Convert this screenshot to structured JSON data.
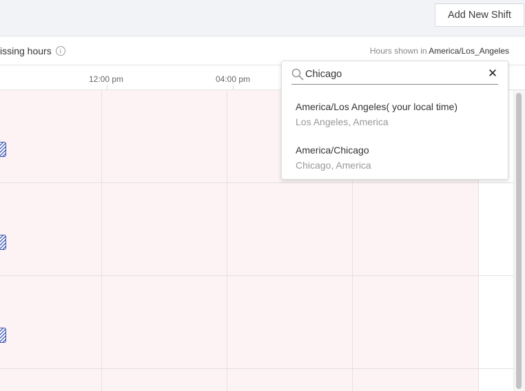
{
  "header": {
    "add_shift_label": "Add New Shift"
  },
  "infobar": {
    "missing_hours_label": "issing hours",
    "info_icon": "i",
    "hours_shown_prefix": "Hours shown in",
    "timezone": "America/Los_Angeles"
  },
  "timeline": {
    "ticks": [
      "12:00 pm",
      "04:00 pm"
    ]
  },
  "timezone_dropdown": {
    "search_value": "Chicago",
    "search_placeholder": "",
    "clear_symbol": "✕",
    "options": [
      {
        "title": "America/Los Angeles( your local time)",
        "subtitle": "Los Angeles, America"
      },
      {
        "title": "America/Chicago",
        "subtitle": "Chicago, America"
      }
    ]
  },
  "colors": {
    "cell_fill": "#fdf3f5",
    "hatch_blue": "#4a62bd",
    "topbar": "#f2f3f6"
  }
}
